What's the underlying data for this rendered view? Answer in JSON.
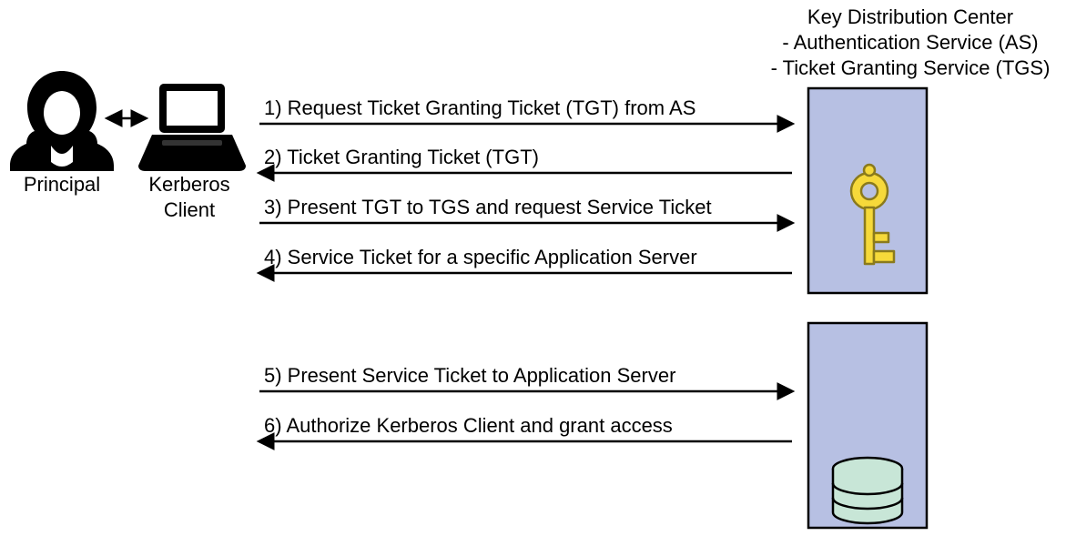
{
  "header": {
    "title": "Key Distribution Center",
    "line1": "- Authentication Service (AS)",
    "line2": "- Ticket Granting Service (TGS)"
  },
  "actors": {
    "principal": "Principal",
    "client_line1": "Kerberos",
    "client_line2": "Client"
  },
  "steps": {
    "s1": "1) Request Ticket Granting Ticket (TGT) from AS",
    "s2": "2) Ticket Granting Ticket (TGT)",
    "s3": "3) Present TGT to TGS and request Service Ticket",
    "s4": "4) Service Ticket for a specific Application Server",
    "s5": "5) Present Service Ticket to Application Server",
    "s6": "6) Authorize Kerberos Client and grant access"
  },
  "colors": {
    "boxFill": "#b7c0e3",
    "boxStroke": "#000000",
    "keyBody": "#f6d93a",
    "keyStroke": "#8a7a1c",
    "dbFill": "#c8e6d7",
    "dbStroke": "#000000"
  }
}
